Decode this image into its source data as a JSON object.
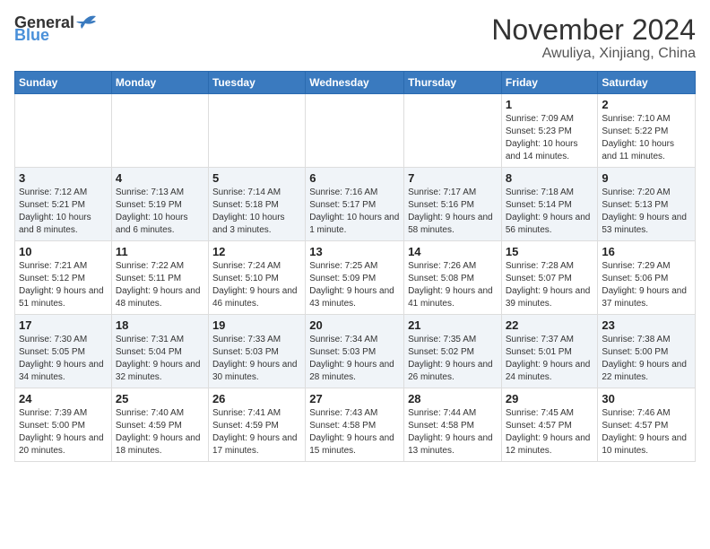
{
  "header": {
    "logo_general": "General",
    "logo_blue": "Blue",
    "month_title": "November 2024",
    "location": "Awuliya, Xinjiang, China"
  },
  "days_of_week": [
    "Sunday",
    "Monday",
    "Tuesday",
    "Wednesday",
    "Thursday",
    "Friday",
    "Saturday"
  ],
  "weeks": [
    [
      {
        "day": "",
        "info": ""
      },
      {
        "day": "",
        "info": ""
      },
      {
        "day": "",
        "info": ""
      },
      {
        "day": "",
        "info": ""
      },
      {
        "day": "",
        "info": ""
      },
      {
        "day": "1",
        "info": "Sunrise: 7:09 AM\nSunset: 5:23 PM\nDaylight: 10 hours and 14 minutes."
      },
      {
        "day": "2",
        "info": "Sunrise: 7:10 AM\nSunset: 5:22 PM\nDaylight: 10 hours and 11 minutes."
      }
    ],
    [
      {
        "day": "3",
        "info": "Sunrise: 7:12 AM\nSunset: 5:21 PM\nDaylight: 10 hours and 8 minutes."
      },
      {
        "day": "4",
        "info": "Sunrise: 7:13 AM\nSunset: 5:19 PM\nDaylight: 10 hours and 6 minutes."
      },
      {
        "day": "5",
        "info": "Sunrise: 7:14 AM\nSunset: 5:18 PM\nDaylight: 10 hours and 3 minutes."
      },
      {
        "day": "6",
        "info": "Sunrise: 7:16 AM\nSunset: 5:17 PM\nDaylight: 10 hours and 1 minute."
      },
      {
        "day": "7",
        "info": "Sunrise: 7:17 AM\nSunset: 5:16 PM\nDaylight: 9 hours and 58 minutes."
      },
      {
        "day": "8",
        "info": "Sunrise: 7:18 AM\nSunset: 5:14 PM\nDaylight: 9 hours and 56 minutes."
      },
      {
        "day": "9",
        "info": "Sunrise: 7:20 AM\nSunset: 5:13 PM\nDaylight: 9 hours and 53 minutes."
      }
    ],
    [
      {
        "day": "10",
        "info": "Sunrise: 7:21 AM\nSunset: 5:12 PM\nDaylight: 9 hours and 51 minutes."
      },
      {
        "day": "11",
        "info": "Sunrise: 7:22 AM\nSunset: 5:11 PM\nDaylight: 9 hours and 48 minutes."
      },
      {
        "day": "12",
        "info": "Sunrise: 7:24 AM\nSunset: 5:10 PM\nDaylight: 9 hours and 46 minutes."
      },
      {
        "day": "13",
        "info": "Sunrise: 7:25 AM\nSunset: 5:09 PM\nDaylight: 9 hours and 43 minutes."
      },
      {
        "day": "14",
        "info": "Sunrise: 7:26 AM\nSunset: 5:08 PM\nDaylight: 9 hours and 41 minutes."
      },
      {
        "day": "15",
        "info": "Sunrise: 7:28 AM\nSunset: 5:07 PM\nDaylight: 9 hours and 39 minutes."
      },
      {
        "day": "16",
        "info": "Sunrise: 7:29 AM\nSunset: 5:06 PM\nDaylight: 9 hours and 37 minutes."
      }
    ],
    [
      {
        "day": "17",
        "info": "Sunrise: 7:30 AM\nSunset: 5:05 PM\nDaylight: 9 hours and 34 minutes."
      },
      {
        "day": "18",
        "info": "Sunrise: 7:31 AM\nSunset: 5:04 PM\nDaylight: 9 hours and 32 minutes."
      },
      {
        "day": "19",
        "info": "Sunrise: 7:33 AM\nSunset: 5:03 PM\nDaylight: 9 hours and 30 minutes."
      },
      {
        "day": "20",
        "info": "Sunrise: 7:34 AM\nSunset: 5:03 PM\nDaylight: 9 hours and 28 minutes."
      },
      {
        "day": "21",
        "info": "Sunrise: 7:35 AM\nSunset: 5:02 PM\nDaylight: 9 hours and 26 minutes."
      },
      {
        "day": "22",
        "info": "Sunrise: 7:37 AM\nSunset: 5:01 PM\nDaylight: 9 hours and 24 minutes."
      },
      {
        "day": "23",
        "info": "Sunrise: 7:38 AM\nSunset: 5:00 PM\nDaylight: 9 hours and 22 minutes."
      }
    ],
    [
      {
        "day": "24",
        "info": "Sunrise: 7:39 AM\nSunset: 5:00 PM\nDaylight: 9 hours and 20 minutes."
      },
      {
        "day": "25",
        "info": "Sunrise: 7:40 AM\nSunset: 4:59 PM\nDaylight: 9 hours and 18 minutes."
      },
      {
        "day": "26",
        "info": "Sunrise: 7:41 AM\nSunset: 4:59 PM\nDaylight: 9 hours and 17 minutes."
      },
      {
        "day": "27",
        "info": "Sunrise: 7:43 AM\nSunset: 4:58 PM\nDaylight: 9 hours and 15 minutes."
      },
      {
        "day": "28",
        "info": "Sunrise: 7:44 AM\nSunset: 4:58 PM\nDaylight: 9 hours and 13 minutes."
      },
      {
        "day": "29",
        "info": "Sunrise: 7:45 AM\nSunset: 4:57 PM\nDaylight: 9 hours and 12 minutes."
      },
      {
        "day": "30",
        "info": "Sunrise: 7:46 AM\nSunset: 4:57 PM\nDaylight: 9 hours and 10 minutes."
      }
    ]
  ]
}
